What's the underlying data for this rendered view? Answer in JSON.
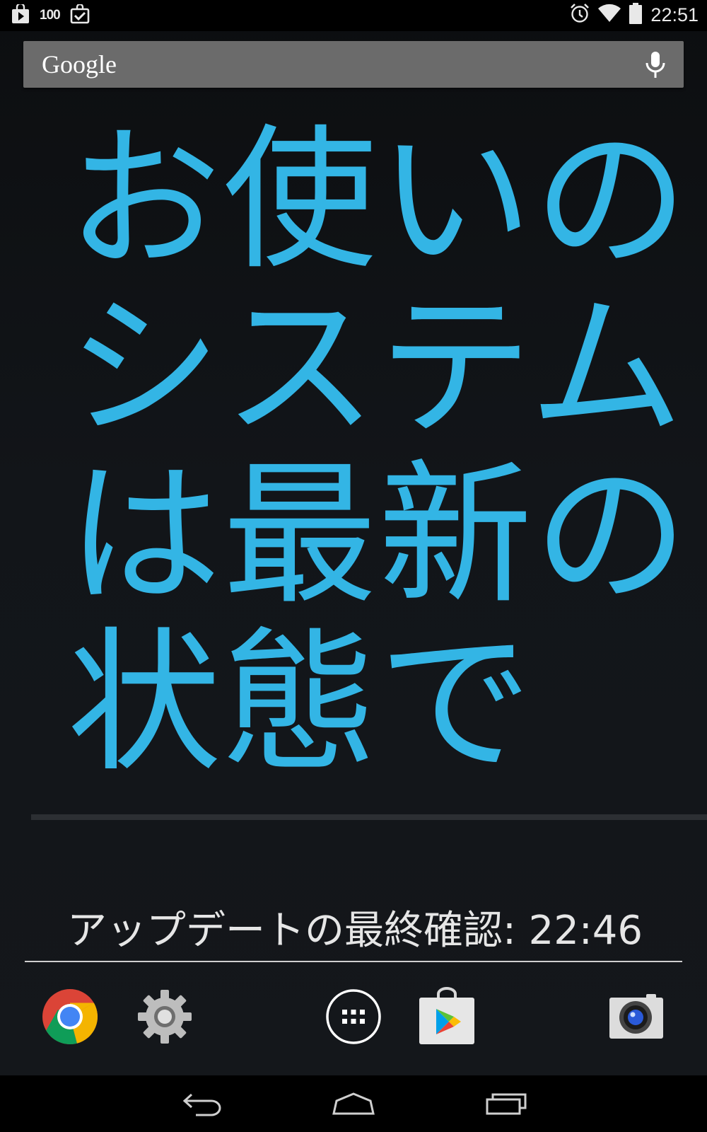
{
  "status_bar": {
    "notification_count": "100",
    "time": "22:51",
    "icons": [
      "play-store-notification-icon",
      "task-done-notification-icon",
      "alarm-icon",
      "wifi-icon",
      "battery-icon"
    ]
  },
  "search": {
    "logo": "Google",
    "icons": [
      "mic-icon"
    ]
  },
  "widget": {
    "message": "お使いのシステムは最新の状態です。",
    "last_check": "アップデートの最終確認: 22:46"
  },
  "dock": {
    "apps": [
      "chrome-icon",
      "settings-icon",
      "app-drawer-icon",
      "play-store-icon",
      "camera-icon"
    ]
  },
  "navigation": {
    "buttons": [
      "back-icon",
      "home-icon",
      "recents-icon"
    ]
  },
  "colors": {
    "accent": "#33b5e5",
    "search_bar": "#6b6b6b"
  }
}
